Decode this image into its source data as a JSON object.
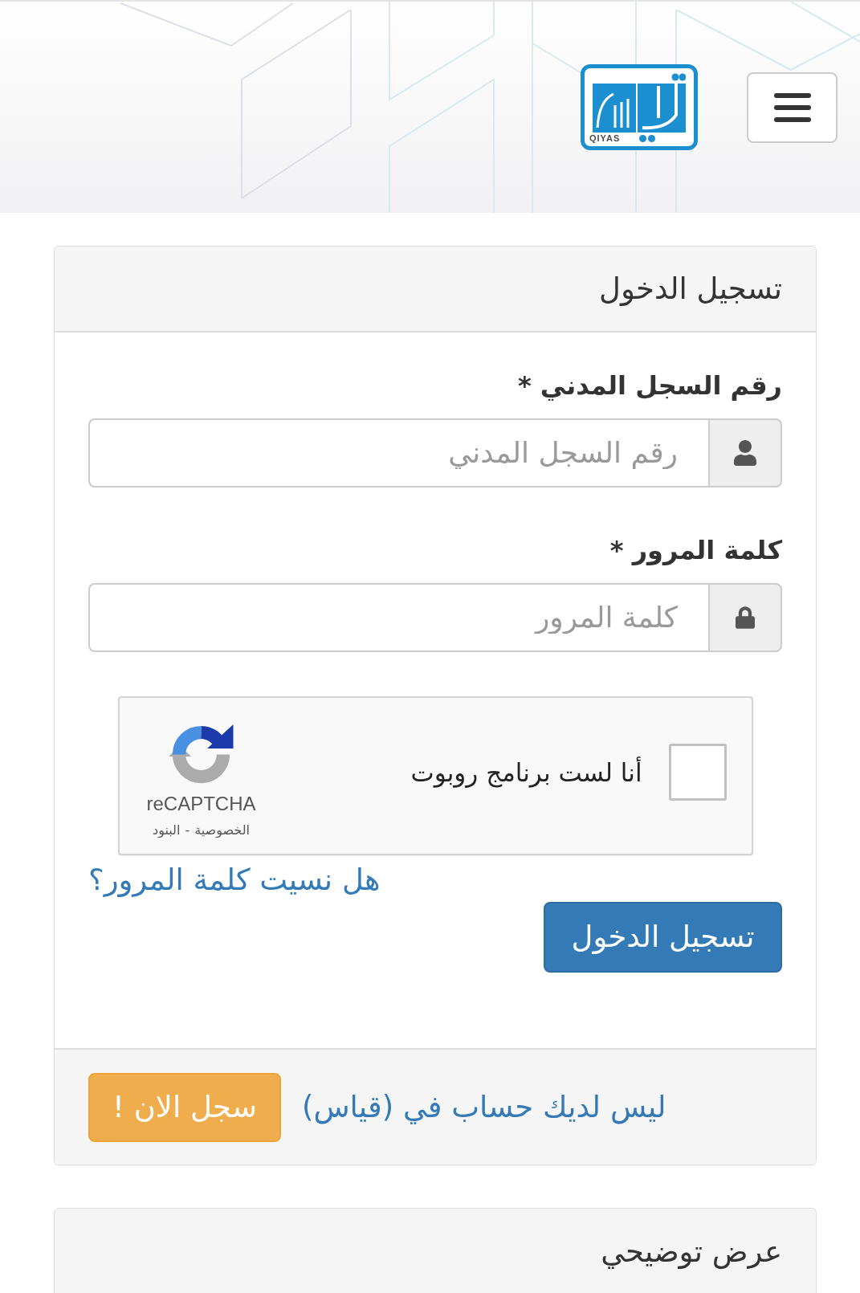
{
  "header": {
    "logo_text": "QIYAS"
  },
  "login_panel": {
    "title": "تسجيل الدخول",
    "fields": [
      {
        "kind": "id",
        "label": "رقم السجل المدني *",
        "placeholder": "رقم السجل المدني"
      },
      {
        "kind": "password",
        "label": "كلمة المرور *",
        "placeholder": "كلمة المرور"
      }
    ],
    "captcha": {
      "checked": false,
      "label": "أنا لست برنامج روبوت",
      "brand": "reCAPTCHA",
      "privacy_link": "الخصوصية",
      "separator": "-",
      "terms_link": "البنود"
    },
    "forgot_link": "هل نسيت كلمة المرور؟",
    "login_button": "تسجيل الدخول",
    "footer": {
      "text": "ليس لديك حساب في (قياس)",
      "register_button": "سجل الان !"
    }
  },
  "demo_panel": {
    "title": "عرض توضيحي"
  }
}
